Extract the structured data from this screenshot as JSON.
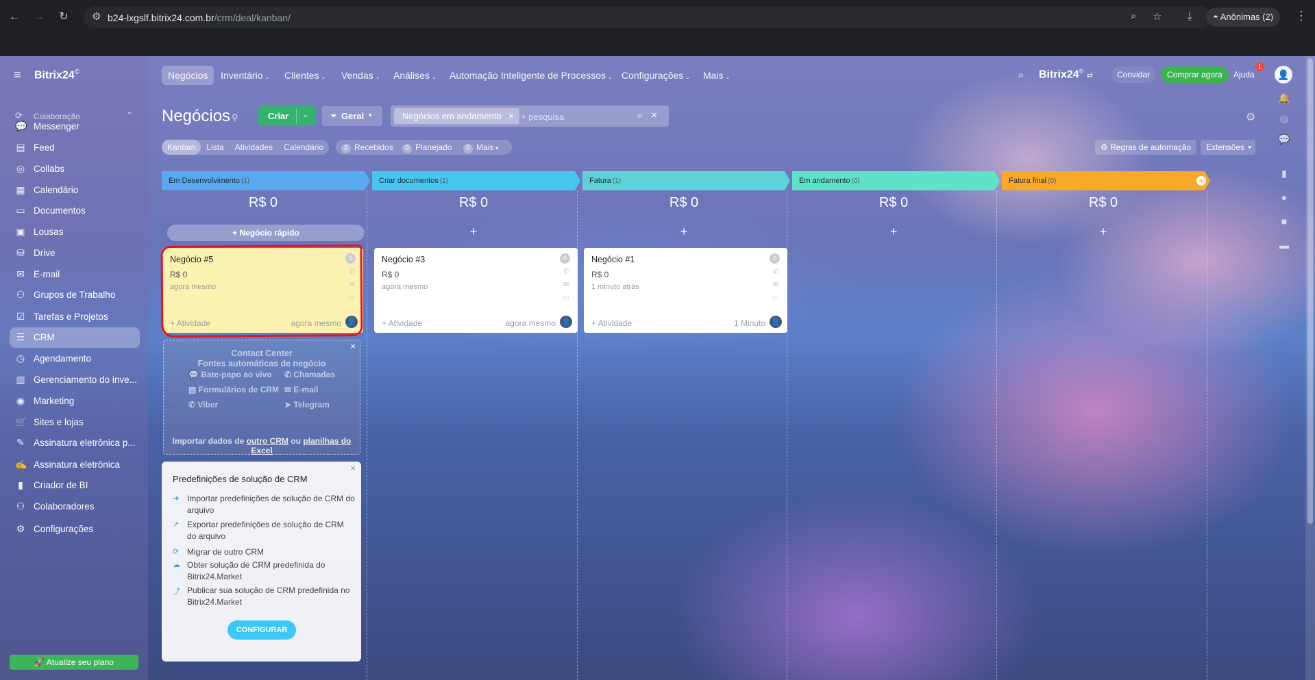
{
  "browser": {
    "url_host": "b24-lxgslf.bitrix24.com.br",
    "url_path": "/crm/deal/kanban/",
    "incognito_label": "Anônimas (2)"
  },
  "sidebar": {
    "logo": "Bitrix24",
    "logo_mark": "©",
    "section": "Colaboração",
    "items": [
      {
        "label": "Messenger",
        "icon": "chat-icon"
      },
      {
        "label": "Feed",
        "icon": "feed-icon"
      },
      {
        "label": "Collabs",
        "icon": "collabs-icon"
      },
      {
        "label": "Calendário",
        "icon": "calendar-icon"
      },
      {
        "label": "Documentos",
        "icon": "document-icon"
      },
      {
        "label": "Lousas",
        "icon": "board-icon"
      },
      {
        "label": "Drive",
        "icon": "drive-icon"
      },
      {
        "label": "E-mail",
        "icon": "mail-icon"
      },
      {
        "label": "Grupos de Trabalho",
        "icon": "group-icon"
      },
      {
        "label": "Tarefas e Projetos",
        "icon": "tasks-icon"
      },
      {
        "label": "CRM",
        "icon": "crm-icon"
      },
      {
        "label": "Agendamento",
        "icon": "booking-icon"
      },
      {
        "label": "Gerenciamento do inve...",
        "icon": "inventory-icon"
      },
      {
        "label": "Marketing",
        "icon": "marketing-icon"
      },
      {
        "label": "Sites e lojas",
        "icon": "cart-icon"
      },
      {
        "label": "Assinatura eletrônica p...",
        "icon": "sign-icon"
      },
      {
        "label": "Assinatura eletrônica",
        "icon": "signature-icon"
      },
      {
        "label": "Criador de BI",
        "icon": "bi-icon"
      },
      {
        "label": "Colaboradores",
        "icon": "employees-icon"
      },
      {
        "label": "Configurações",
        "icon": "gear-icon"
      }
    ],
    "active": "CRM",
    "upgrade": "Atualize seu plano"
  },
  "topnav": {
    "items": [
      "Negócios",
      "Inventário",
      "Clientes",
      "Vendas",
      "Análises",
      "Automação Inteligente de Processos",
      "Configurações",
      "Mais"
    ],
    "brand": "Bitrix24",
    "invite": "Convidar",
    "buy": "Comprar agora",
    "help": "Ajuda",
    "help_badge": "1"
  },
  "page": {
    "title": "Negócios",
    "create": "Criar",
    "pipeline": "Geral",
    "filter_chip": "Negócios em andamento",
    "search_placeholder": "+ pesquisa",
    "views": [
      "Kanban",
      "Lista",
      "Atividades",
      "Calendário"
    ],
    "counters": [
      {
        "n": "0",
        "label": "Recebidos"
      },
      {
        "n": "0",
        "label": "Planejado"
      },
      {
        "n": "0",
        "label": "Mais"
      }
    ],
    "automation_rules": "Regras de automação",
    "extensions": "Extensões"
  },
  "stages": [
    {
      "name": "Em Desenvolvimento",
      "count": "(1)",
      "sum": "R$ 0",
      "color": "#59a9ef"
    },
    {
      "name": "Criar documentos",
      "count": "(1)",
      "sum": "R$ 0",
      "color": "#47c6ef"
    },
    {
      "name": "Fatura",
      "count": "(1)",
      "sum": "R$ 0",
      "color": "#5fd1d9"
    },
    {
      "name": "Em andamento",
      "count": "(0)",
      "sum": "R$ 0",
      "color": "#5fe3c8"
    },
    {
      "name": "Fatura final",
      "count": "(0)",
      "sum": "R$ 0",
      "color": "#f8a927"
    }
  ],
  "quick_deal": "Negócio rápido",
  "add_symbol": "+",
  "cards": [
    {
      "title": "Negócio #5",
      "amount": "R$ 0",
      "date": "agora mesmo",
      "badge": "0",
      "activity": "+ Atividade",
      "when": "agora mesmo"
    },
    {
      "title": "Negócio #3",
      "amount": "R$ 0",
      "date": "agora mesmo",
      "badge": "0",
      "activity": "+ Atividade",
      "when": "agora mesmo"
    },
    {
      "title": "Negócio #1",
      "amount": "R$ 0",
      "date": "1 minuto atrás",
      "badge": "0",
      "activity": "+ Atividade",
      "when": "1 Minuto"
    }
  ],
  "contact_center": {
    "title": "Contact Center",
    "subtitle": "Fontes automáticas de negócio",
    "sources": [
      "Bate-papo ao vivo",
      "Chamadas",
      "Formulários de CRM",
      "E-mail",
      "Viber",
      "Telegram"
    ],
    "import_prefix": "Importar dados de",
    "import_link1": "outro CRM",
    "import_or": "ou",
    "import_link2": "planilhas do Excel"
  },
  "presets": {
    "title": "Predefinições de solução de CRM",
    "items": [
      "Importar predefinições de solução de CRM do arquivo",
      "Exportar predefinições de solução de CRM do arquivo",
      "Migrar de outro CRM",
      "Obter solução de CRM predefinida do Bitrix24.Market",
      "Publicar sua solução de CRM predefinida no Bitrix24.Market"
    ],
    "button": "CONFIGURAR"
  }
}
